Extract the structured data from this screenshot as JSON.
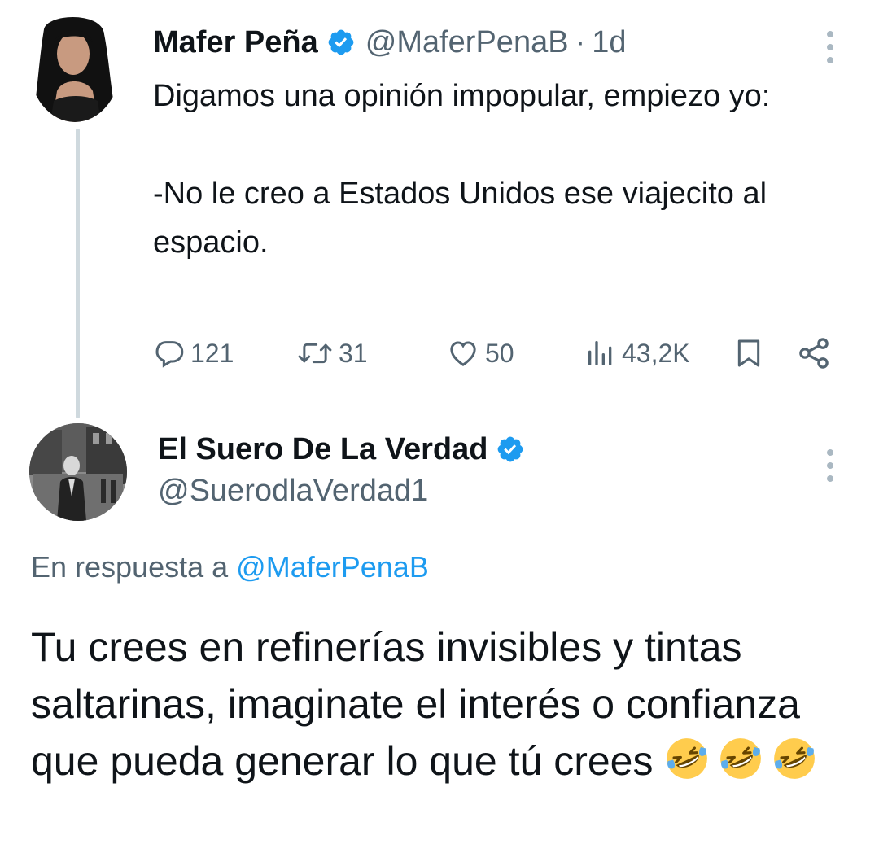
{
  "colors": {
    "accent": "#1d9bf0",
    "text_primary": "#0f1419",
    "text_secondary": "#536471",
    "thread_line": "#cfd9de"
  },
  "tweet1": {
    "name": "Mafer Peña",
    "handle": "@MaferPenaB",
    "separator": "·",
    "time": "1d",
    "text": "Digamos una opinión impopular, empiezo yo:\n\n-No le creo a Estados Unidos ese viajecito al espacio.",
    "actions": {
      "replies": "121",
      "retweets": "31",
      "likes": "50",
      "views": "43,2K"
    },
    "icons": [
      "verified-badge-icon",
      "more-options-icon",
      "reply-icon",
      "retweet-icon",
      "like-icon",
      "views-icon",
      "bookmark-icon",
      "share-icon"
    ]
  },
  "tweet2": {
    "name": "El Suero De La Verdad",
    "handle": "@SuerodlaVerdad1",
    "reply_prefix": "En respuesta a",
    "reply_mention": "@MaferPenaB",
    "text": "Tu crees en refinerías invisibles y tintas saltarinas, imaginate el interés o confianza que pueda generar lo que tú crees",
    "emoji": [
      "rolling-on-floor-laughing",
      "rolling-on-floor-laughing",
      "rolling-on-floor-laughing"
    ]
  }
}
